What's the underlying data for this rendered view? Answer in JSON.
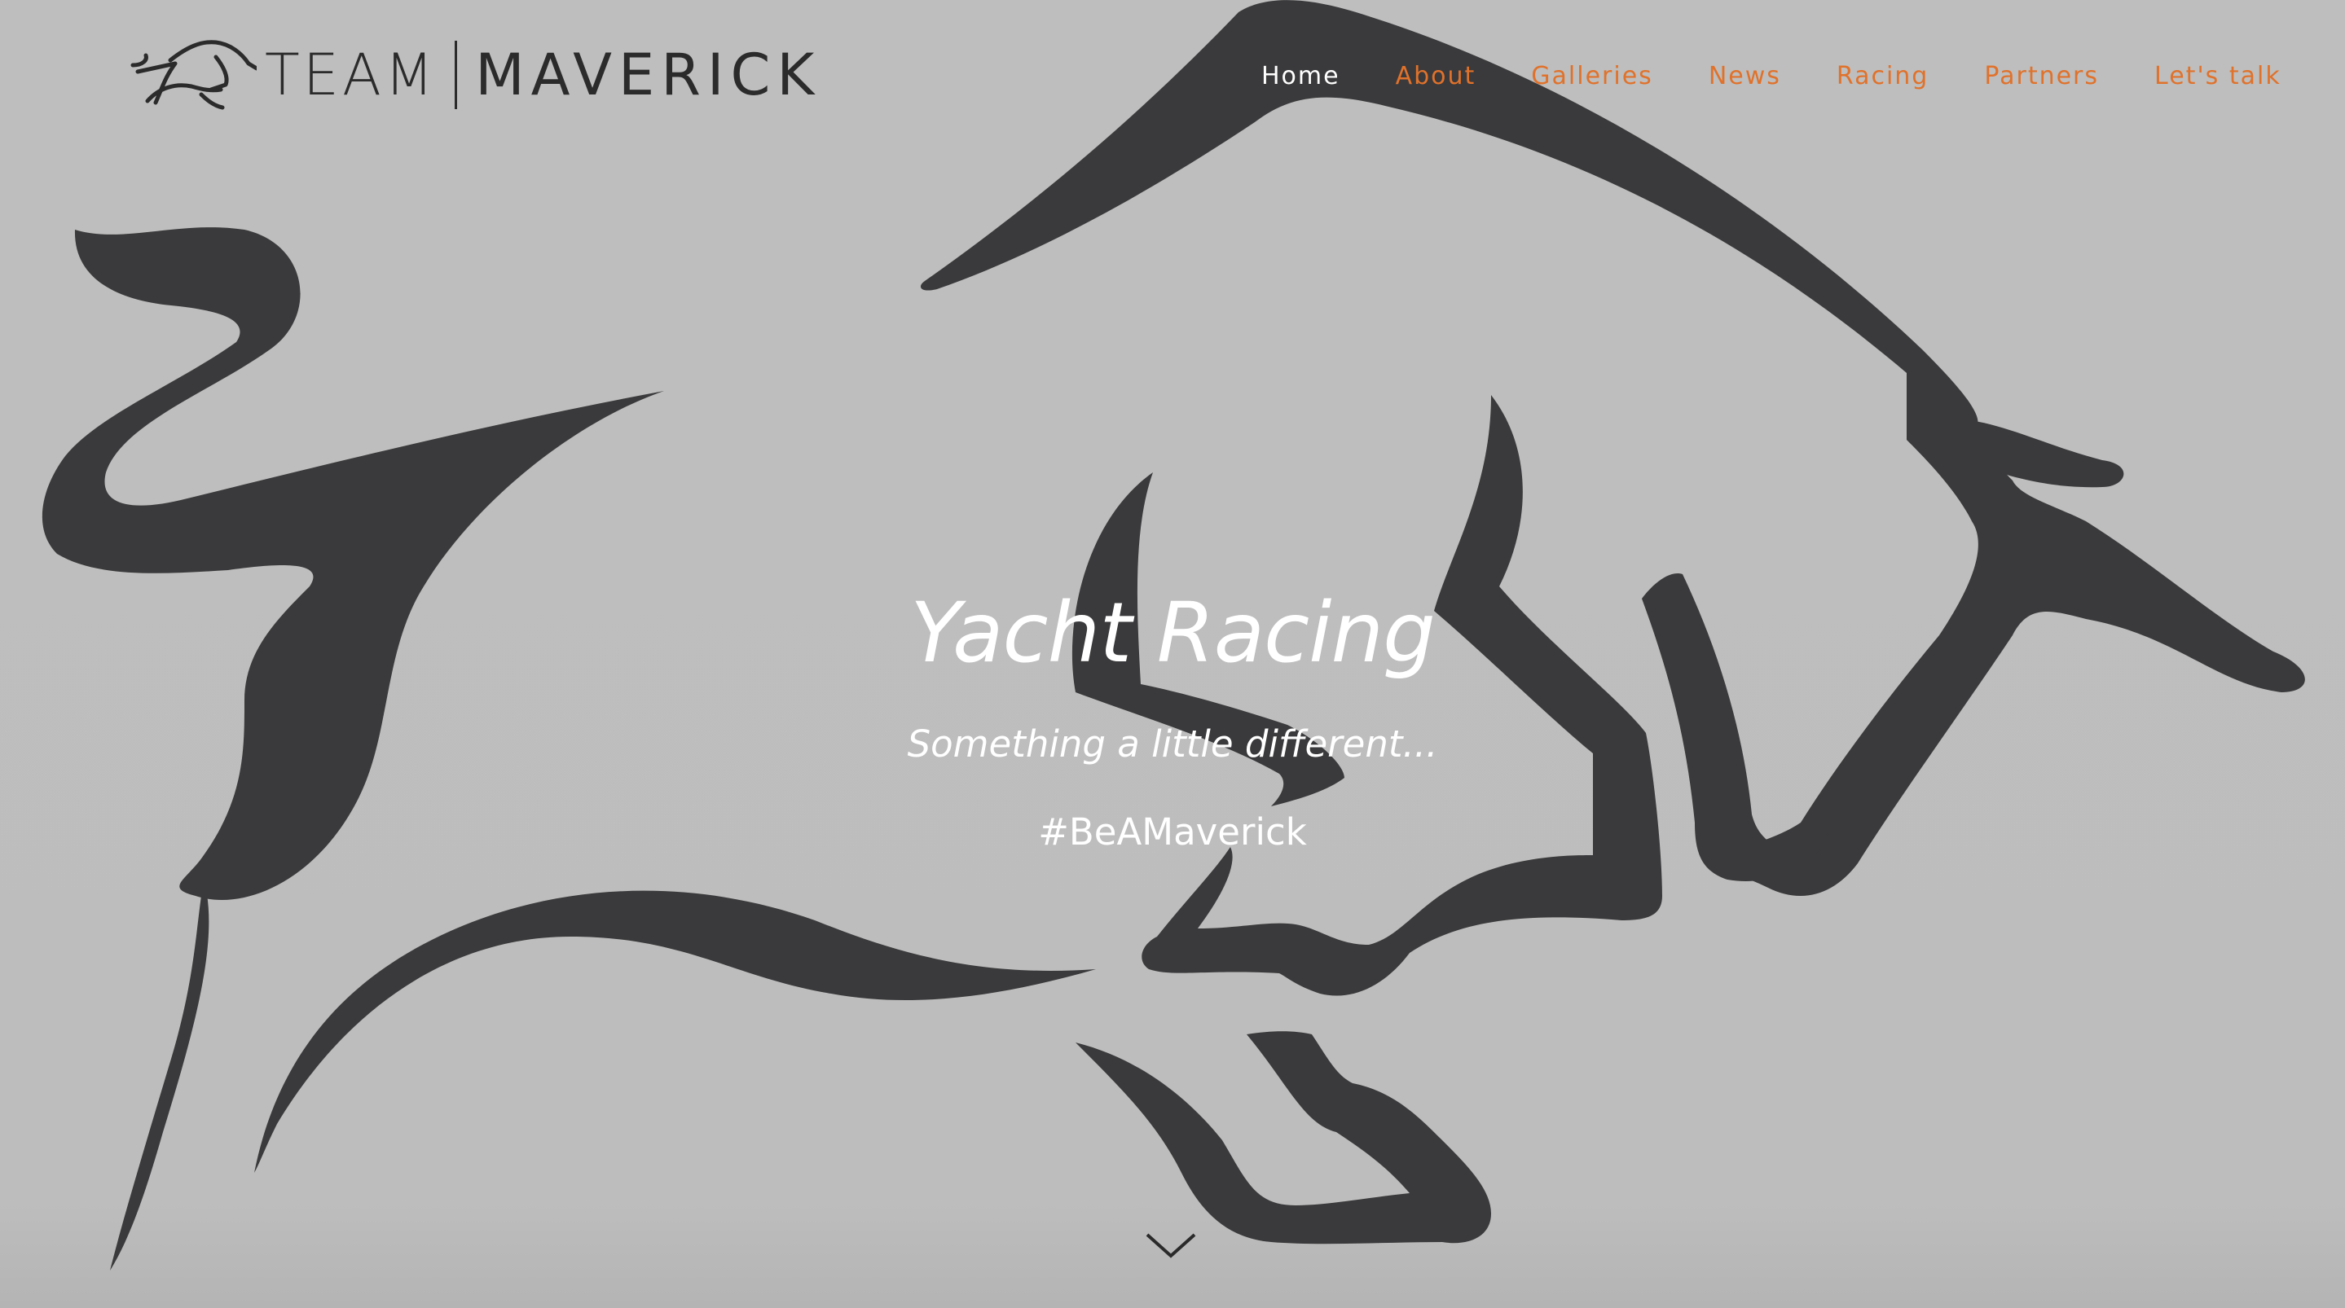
{
  "brand": {
    "team": "TEAM",
    "name": "MAVERICK",
    "logo_icon": "bull-icon"
  },
  "nav": {
    "items": [
      {
        "label": "Home",
        "active": true
      },
      {
        "label": "About",
        "active": false
      },
      {
        "label": "Galleries",
        "active": false
      },
      {
        "label": "News",
        "active": false
      },
      {
        "label": "Racing",
        "active": false
      },
      {
        "label": "Partners",
        "active": false
      },
      {
        "label": "Let's talk",
        "active": false
      }
    ]
  },
  "hero": {
    "title": "Yacht Racing",
    "subtitle": "Something a little different...",
    "hashtag": "#BeAMaverick",
    "scroll_icon": "chevron-down-icon"
  },
  "colors": {
    "background": "#bdbdbd",
    "bull": "#3a3a3c",
    "nav_link": "#e0722b",
    "nav_active": "#ffffff",
    "hero_text": "#ffffff"
  }
}
